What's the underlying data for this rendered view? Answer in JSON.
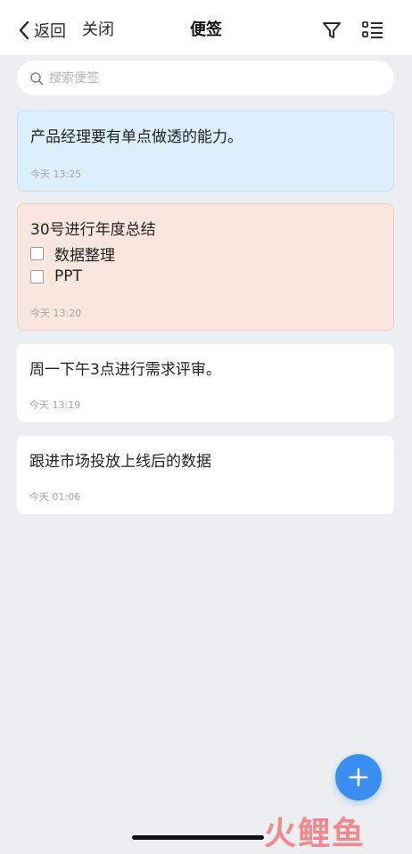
{
  "header": {
    "back_label": "返回",
    "close_label": "关闭",
    "title": "便签"
  },
  "search": {
    "placeholder": "搜索便签",
    "value": ""
  },
  "notes": [
    {
      "text": "产品经理要有单点做透的能力。",
      "time": "今天 13:25",
      "color": "#ddeefc"
    },
    {
      "text": "30号进行年度总结",
      "checklist": [
        {
          "label": "数据整理",
          "checked": false
        },
        {
          "label": "PPT",
          "checked": false
        }
      ],
      "time": "今天 13:20",
      "color": "#f8e6df"
    },
    {
      "text": "周一下午3点进行需求评审。",
      "time": "今天 13:19",
      "color": "#ffffff"
    },
    {
      "text": "跟进市场投放上线后的数据",
      "time": "今天 01:06",
      "color": "#ffffff"
    }
  ],
  "fab": {
    "icon": "plus-icon",
    "color": "#3b8ef1"
  },
  "watermark": "火鲤鱼",
  "icons": {
    "back": "chevron-left-icon",
    "filter": "filter-icon",
    "list": "list-icon",
    "search": "search-icon"
  }
}
